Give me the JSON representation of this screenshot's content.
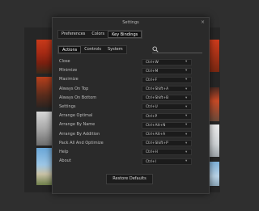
{
  "dialog": {
    "title": "Settings",
    "close_glyph": "×"
  },
  "top_tabs": [
    "Preferences",
    "Colors",
    "Key Bindings"
  ],
  "top_tabs_active": "Key Bindings",
  "sub_tabs": [
    "Actions",
    "Controls",
    "System"
  ],
  "sub_tabs_active": "Actions",
  "search": {
    "icon": "search-icon",
    "value": ""
  },
  "bindings": [
    {
      "action": "Close",
      "shortcut": "Ctrl+W"
    },
    {
      "action": "Minimize",
      "shortcut": "Ctrl+M"
    },
    {
      "action": "Maximize",
      "shortcut": "Ctrl+F"
    },
    {
      "action": "Always On Top",
      "shortcut": "Ctrl+Shift+A"
    },
    {
      "action": "Always On Bottom",
      "shortcut": "Ctrl+Shift+B"
    },
    {
      "action": "Settings",
      "shortcut": "Ctrl+U"
    },
    {
      "action": "Arrange Optimal",
      "shortcut": "Ctrl+P"
    },
    {
      "action": "Arrange By Name",
      "shortcut": "Ctrl+Alt+N"
    },
    {
      "action": "Arrange By Addition",
      "shortcut": "Ctrl+Alt+A"
    },
    {
      "action": "Pack All And Optimize",
      "shortcut": "Ctrl+Shift+P"
    },
    {
      "action": "Help",
      "shortcut": "Ctrl+H"
    },
    {
      "action": "About",
      "shortcut": "Ctrl+I"
    }
  ],
  "dropdown_glyph": "▾",
  "restore_label": "Restore Defaults"
}
